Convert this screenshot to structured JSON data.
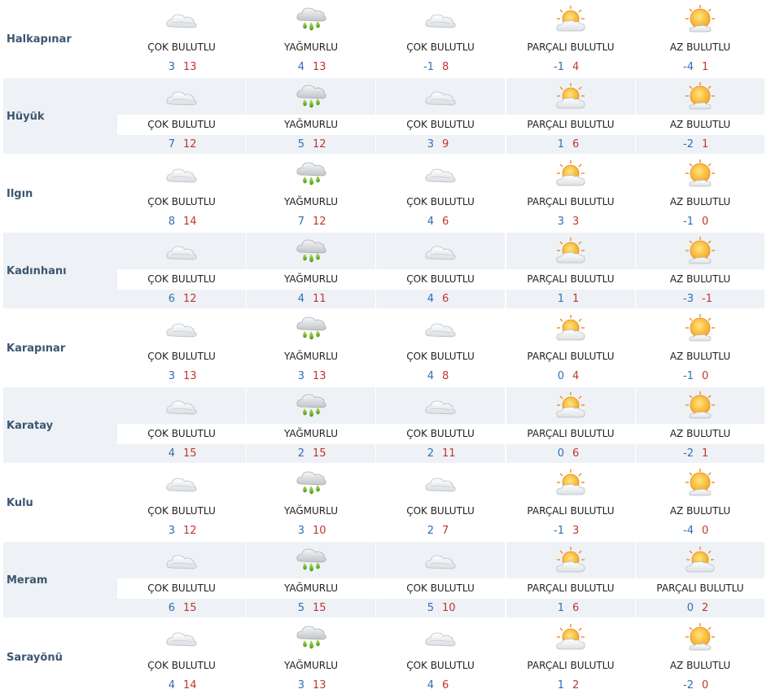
{
  "colors": {
    "min_temp": "#2f6fb5",
    "max_temp": "#c1352f",
    "city": "#3d5670",
    "row_alt": "#eef2f6"
  },
  "rows": [
    {
      "city": "Halkapınar",
      "days": [
        {
          "icon": "cloudy-icon",
          "cond": "ÇOK BULUTLU",
          "min": "3",
          "max": "13"
        },
        {
          "icon": "rain-icon",
          "cond": "YAĞMURLU",
          "min": "4",
          "max": "13"
        },
        {
          "icon": "cloudy-icon",
          "cond": "ÇOK BULUTLU",
          "min": "-1",
          "max": "8"
        },
        {
          "icon": "partly-cloudy-icon",
          "cond": "PARÇALI BULUTLU",
          "min": "-1",
          "max": "4"
        },
        {
          "icon": "mostly-sunny-icon",
          "cond": "AZ BULUTLU",
          "min": "-4",
          "max": "1"
        }
      ]
    },
    {
      "city": "Hüyük",
      "days": [
        {
          "icon": "cloudy-icon",
          "cond": "ÇOK BULUTLU",
          "min": "7",
          "max": "12"
        },
        {
          "icon": "rain-icon",
          "cond": "YAĞMURLU",
          "min": "5",
          "max": "12"
        },
        {
          "icon": "cloudy-icon",
          "cond": "ÇOK BULUTLU",
          "min": "3",
          "max": "9"
        },
        {
          "icon": "partly-cloudy-icon",
          "cond": "PARÇALI BULUTLU",
          "min": "1",
          "max": "6"
        },
        {
          "icon": "mostly-sunny-icon",
          "cond": "AZ BULUTLU",
          "min": "-2",
          "max": "1"
        }
      ]
    },
    {
      "city": "Ilgın",
      "days": [
        {
          "icon": "cloudy-icon",
          "cond": "ÇOK BULUTLU",
          "min": "8",
          "max": "14"
        },
        {
          "icon": "rain-icon",
          "cond": "YAĞMURLU",
          "min": "7",
          "max": "12"
        },
        {
          "icon": "cloudy-icon",
          "cond": "ÇOK BULUTLU",
          "min": "4",
          "max": "6"
        },
        {
          "icon": "partly-cloudy-icon",
          "cond": "PARÇALI BULUTLU",
          "min": "3",
          "max": "3"
        },
        {
          "icon": "mostly-sunny-icon",
          "cond": "AZ BULUTLU",
          "min": "-1",
          "max": "0"
        }
      ]
    },
    {
      "city": "Kadınhanı",
      "days": [
        {
          "icon": "cloudy-icon",
          "cond": "ÇOK BULUTLU",
          "min": "6",
          "max": "12"
        },
        {
          "icon": "rain-icon",
          "cond": "YAĞMURLU",
          "min": "4",
          "max": "11"
        },
        {
          "icon": "cloudy-icon",
          "cond": "ÇOK BULUTLU",
          "min": "4",
          "max": "6"
        },
        {
          "icon": "partly-cloudy-icon",
          "cond": "PARÇALI BULUTLU",
          "min": "1",
          "max": "1"
        },
        {
          "icon": "mostly-sunny-icon",
          "cond": "AZ BULUTLU",
          "min": "-3",
          "max": "-1"
        }
      ]
    },
    {
      "city": "Karapınar",
      "days": [
        {
          "icon": "cloudy-icon",
          "cond": "ÇOK BULUTLU",
          "min": "3",
          "max": "13"
        },
        {
          "icon": "rain-icon",
          "cond": "YAĞMURLU",
          "min": "3",
          "max": "13"
        },
        {
          "icon": "cloudy-icon",
          "cond": "ÇOK BULUTLU",
          "min": "4",
          "max": "8"
        },
        {
          "icon": "partly-cloudy-icon",
          "cond": "PARÇALI BULUTLU",
          "min": "0",
          "max": "4"
        },
        {
          "icon": "mostly-sunny-icon",
          "cond": "AZ BULUTLU",
          "min": "-1",
          "max": "0"
        }
      ]
    },
    {
      "city": "Karatay",
      "days": [
        {
          "icon": "cloudy-icon",
          "cond": "ÇOK BULUTLU",
          "min": "4",
          "max": "15"
        },
        {
          "icon": "rain-icon",
          "cond": "YAĞMURLU",
          "min": "2",
          "max": "15"
        },
        {
          "icon": "cloudy-icon",
          "cond": "ÇOK BULUTLU",
          "min": "2",
          "max": "11"
        },
        {
          "icon": "partly-cloudy-icon",
          "cond": "PARÇALI BULUTLU",
          "min": "0",
          "max": "6"
        },
        {
          "icon": "mostly-sunny-icon",
          "cond": "AZ BULUTLU",
          "min": "-2",
          "max": "1"
        }
      ]
    },
    {
      "city": "Kulu",
      "days": [
        {
          "icon": "cloudy-icon",
          "cond": "ÇOK BULUTLU",
          "min": "3",
          "max": "12"
        },
        {
          "icon": "rain-icon",
          "cond": "YAĞMURLU",
          "min": "3",
          "max": "10"
        },
        {
          "icon": "cloudy-icon",
          "cond": "ÇOK BULUTLU",
          "min": "2",
          "max": "7"
        },
        {
          "icon": "partly-cloudy-icon",
          "cond": "PARÇALI BULUTLU",
          "min": "-1",
          "max": "3"
        },
        {
          "icon": "mostly-sunny-icon",
          "cond": "AZ BULUTLU",
          "min": "-4",
          "max": "0"
        }
      ]
    },
    {
      "city": "Meram",
      "days": [
        {
          "icon": "cloudy-icon",
          "cond": "ÇOK BULUTLU",
          "min": "6",
          "max": "15"
        },
        {
          "icon": "rain-icon",
          "cond": "YAĞMURLU",
          "min": "5",
          "max": "15"
        },
        {
          "icon": "cloudy-icon",
          "cond": "ÇOK BULUTLU",
          "min": "5",
          "max": "10"
        },
        {
          "icon": "partly-cloudy-icon",
          "cond": "PARÇALI BULUTLU",
          "min": "1",
          "max": "6"
        },
        {
          "icon": "partly-cloudy-icon",
          "cond": "PARÇALI BULUTLU",
          "min": "0",
          "max": "2"
        }
      ]
    },
    {
      "city": "Sarayönü",
      "days": [
        {
          "icon": "cloudy-icon",
          "cond": "ÇOK BULUTLU",
          "min": "4",
          "max": "14"
        },
        {
          "icon": "rain-icon",
          "cond": "YAĞMURLU",
          "min": "3",
          "max": "13"
        },
        {
          "icon": "cloudy-icon",
          "cond": "ÇOK BULUTLU",
          "min": "4",
          "max": "6"
        },
        {
          "icon": "partly-cloudy-icon",
          "cond": "PARÇALI BULUTLU",
          "min": "1",
          "max": "2"
        },
        {
          "icon": "mostly-sunny-icon",
          "cond": "AZ BULUTLU",
          "min": "-2",
          "max": "0"
        }
      ]
    }
  ]
}
